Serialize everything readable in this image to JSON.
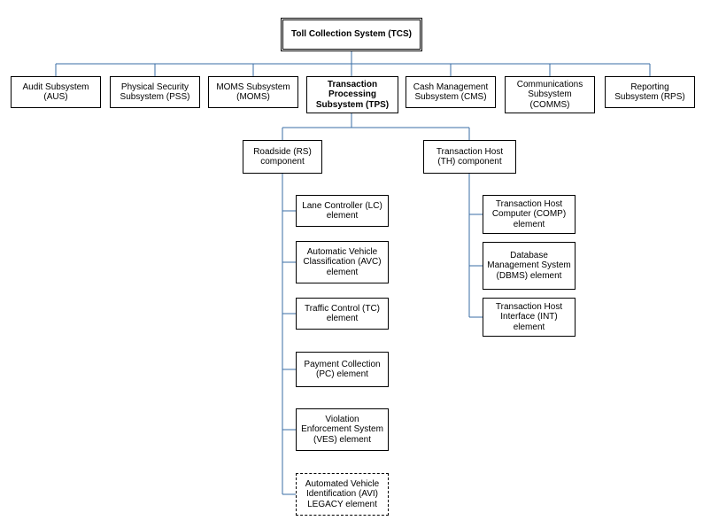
{
  "root": {
    "label": "Toll Collection System (TCS)"
  },
  "subsystems": {
    "aus": "Audit Subsystem (AUS)",
    "pss": "Physical Security Subsystem (PSS)",
    "moms": "MOMS Subsystem (MOMS)",
    "tps": "Transaction Processing Subsystem (TPS)",
    "cms": "Cash Management Subsystem (CMS)",
    "comms": "Communications Subsystem (COMMS)",
    "rps": "Reporting Subsystem (RPS)"
  },
  "tps_children": {
    "rs": "Roadside (RS) component",
    "th": "Transaction Host (TH) component"
  },
  "rs_elements": {
    "lc": "Lane Controller (LC) element",
    "avc": "Automatic Vehicle Classification (AVC) element",
    "tc": "Traffic Control (TC) element",
    "pc": "Payment Collection (PC) element",
    "ves": "Violation Enforcement System (VES) element",
    "avi": "Automated Vehicle Identification (AVI) LEGACY element"
  },
  "th_elements": {
    "comp": "Transaction Host Computer (COMP) element",
    "dbms": "Database Management System (DBMS) element",
    "int": "Transaction Host Interface (INT) element"
  }
}
